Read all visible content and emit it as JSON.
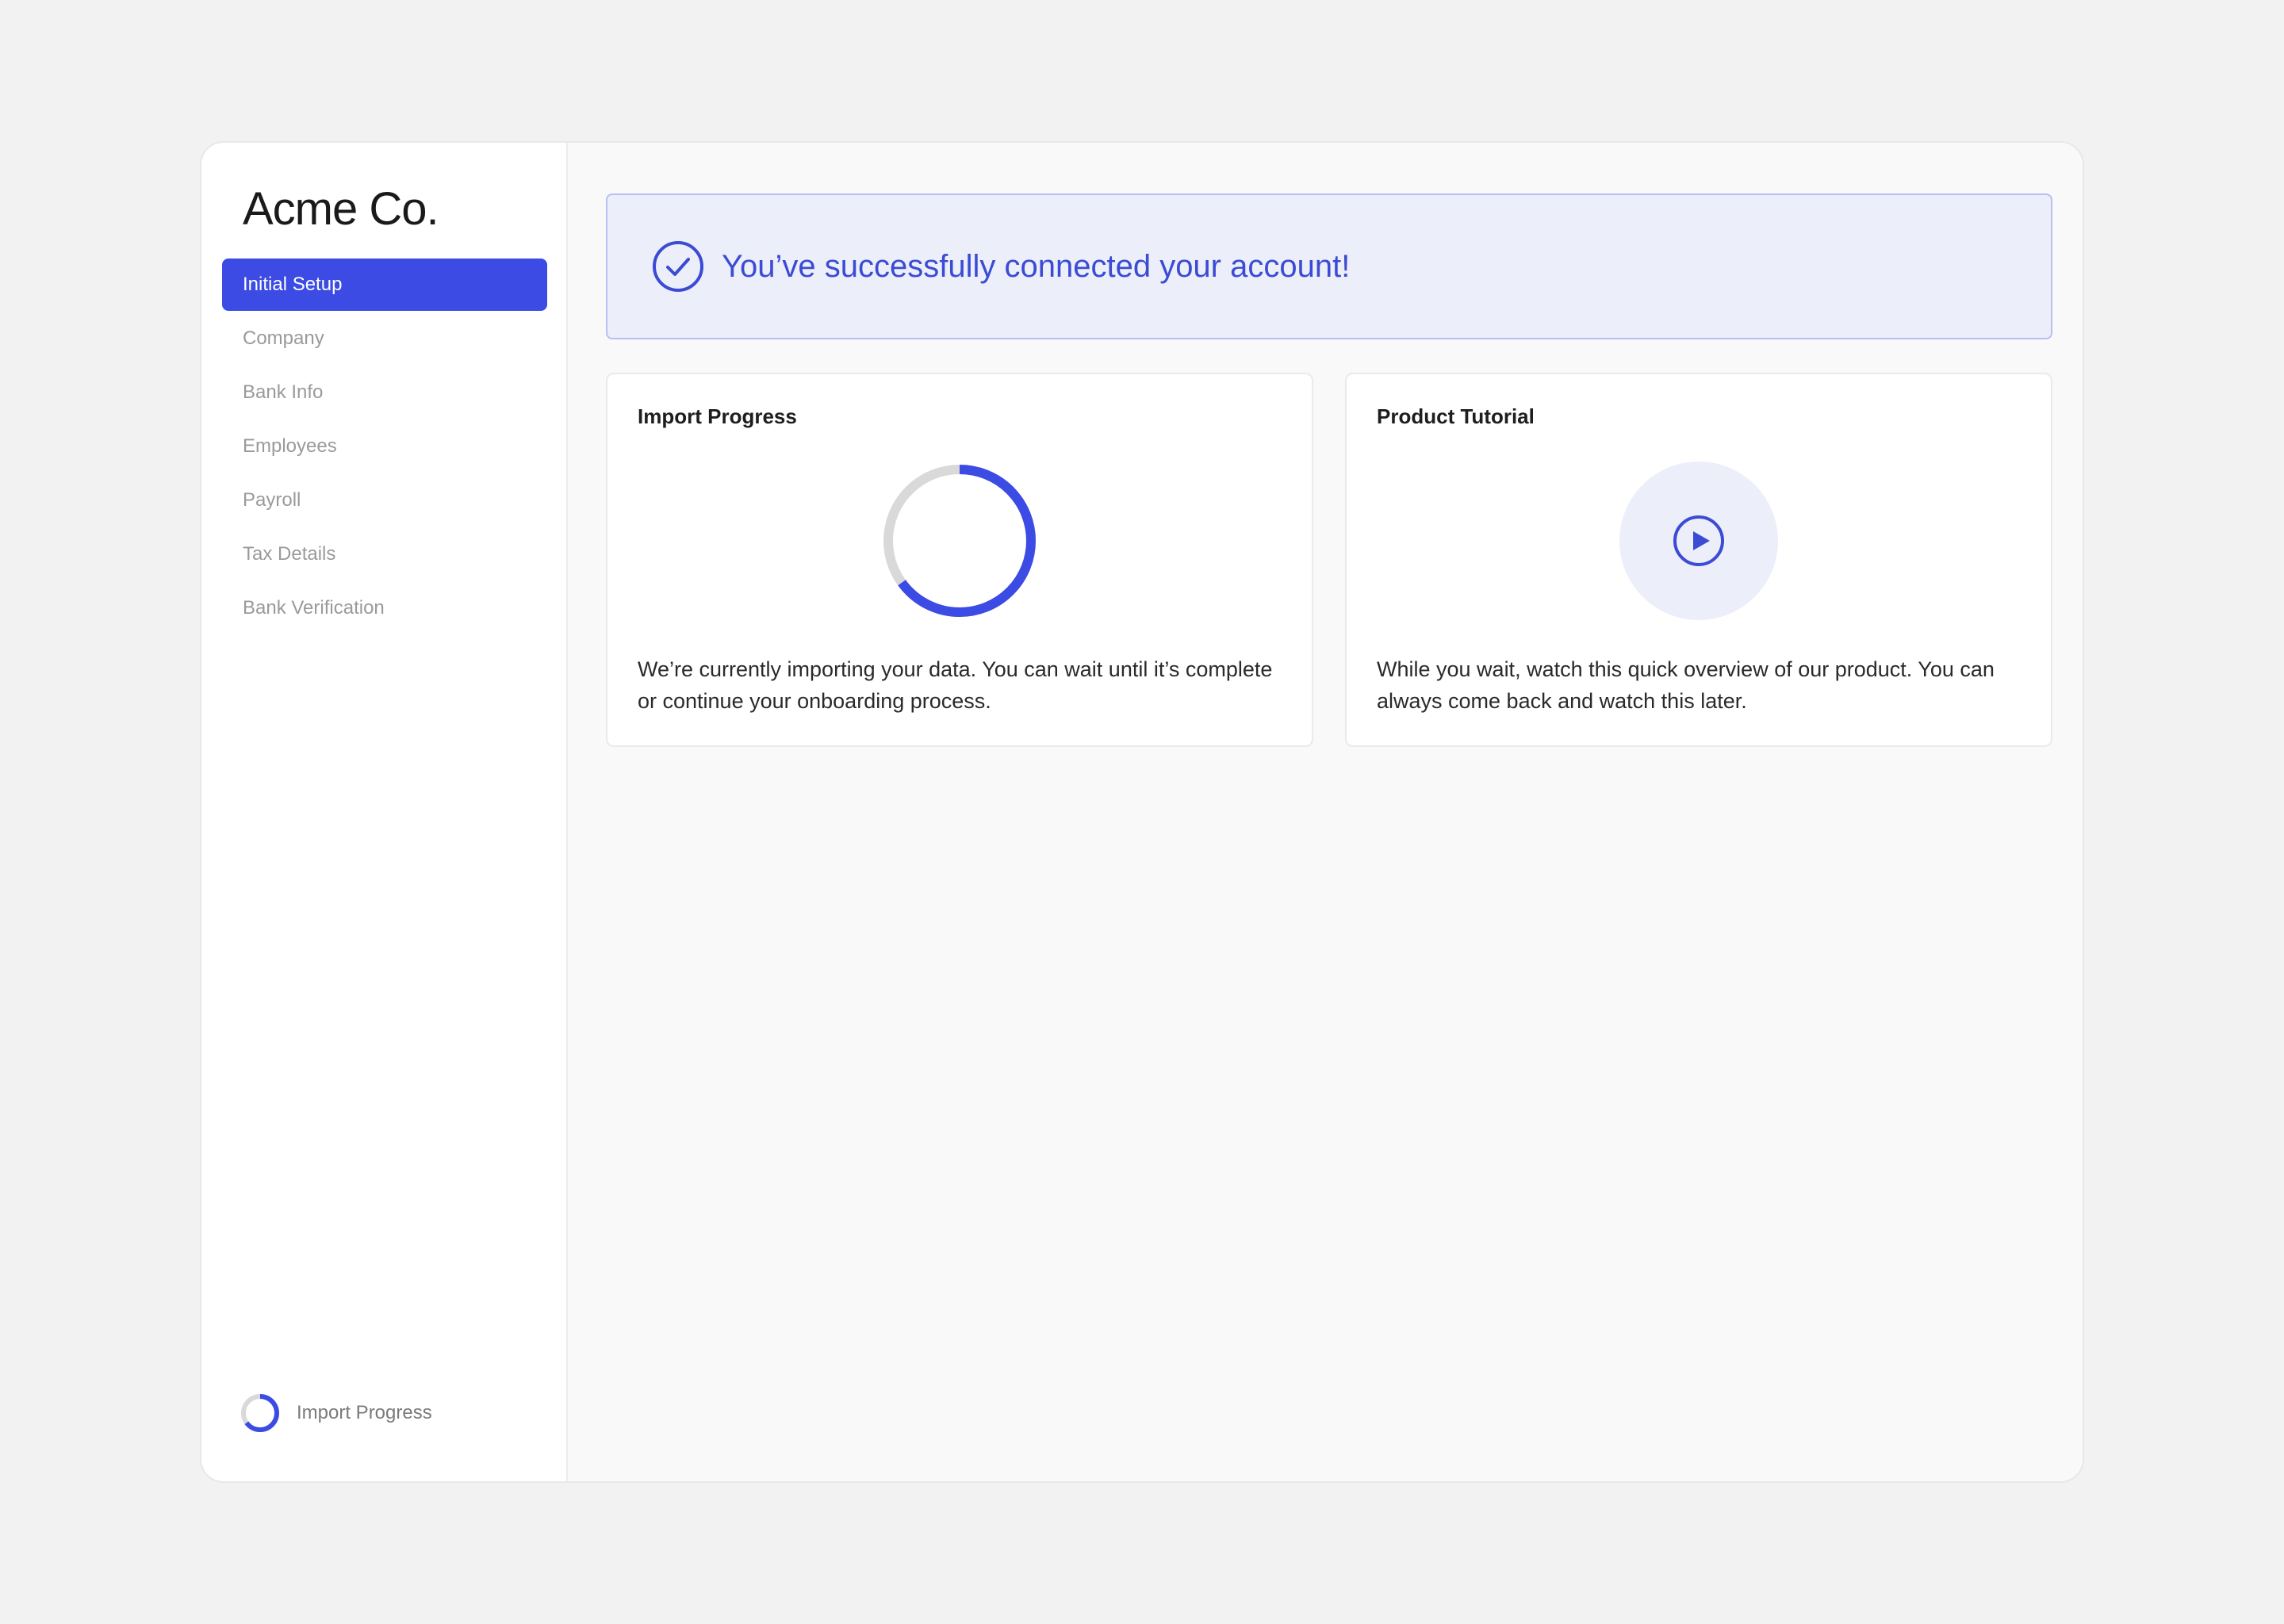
{
  "app": {
    "logo": "Acme Co."
  },
  "sidebar": {
    "items": [
      {
        "label": "Initial Setup",
        "active": true
      },
      {
        "label": "Company",
        "active": false
      },
      {
        "label": "Bank Info",
        "active": false
      },
      {
        "label": "Employees",
        "active": false
      },
      {
        "label": "Payroll",
        "active": false
      },
      {
        "label": "Tax Details",
        "active": false
      },
      {
        "label": "Bank Verification",
        "active": false
      }
    ],
    "footer": {
      "label": "Import Progress",
      "icon": "progress-ring-icon",
      "progress": 0.65
    }
  },
  "banner": {
    "icon": "check-circle-icon",
    "text": "You’ve successfully connected your account!"
  },
  "cards": {
    "import": {
      "title": "Import Progress",
      "body": "We’re currently importing your data. You can wait until it’s complete or continue your onboarding process.",
      "progress": 0.65
    },
    "tutorial": {
      "title": "Product Tutorial",
      "icon": "play-circle-icon",
      "body": "While you wait, watch this quick overview of our product. You can always come back and watch this later."
    }
  },
  "colors": {
    "accent": "#3b4be3",
    "banner_bg": "#eceffa",
    "banner_border": "#b8bff2",
    "ring_track": "#d9d9d9"
  }
}
